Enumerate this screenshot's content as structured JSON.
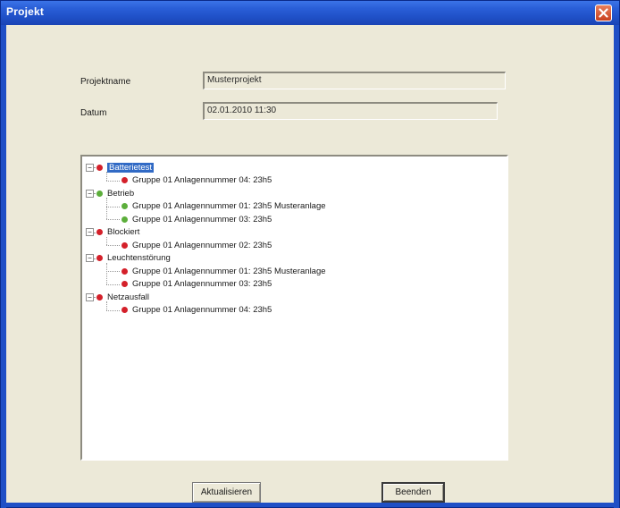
{
  "window": {
    "title": "Projekt"
  },
  "fields": {
    "project_name_label": "Projektname",
    "project_name_value": "Musterprojekt",
    "date_label": "Datum",
    "date_value": "02.01.2010 11:30"
  },
  "tree": {
    "status_colors": {
      "error": "#d4202a",
      "ok": "#5cae3b"
    },
    "groups": [
      {
        "label": "Batterietest",
        "status": "error",
        "selected": true,
        "children": [
          {
            "label": "Gruppe 01 Anlagennummer 04: 23h5",
            "status": "error"
          }
        ]
      },
      {
        "label": "Betrieb",
        "status": "ok",
        "children": [
          {
            "label": "Gruppe 01 Anlagennummer 01: 23h5 Musteranlage",
            "status": "ok"
          },
          {
            "label": "Gruppe 01 Anlagennummer 03: 23h5",
            "status": "ok"
          }
        ]
      },
      {
        "label": "Blockiert",
        "status": "error",
        "children": [
          {
            "label": "Gruppe 01 Anlagennummer 02: 23h5",
            "status": "error"
          }
        ]
      },
      {
        "label": "Leuchtenstörung",
        "status": "error",
        "children": [
          {
            "label": "Gruppe 01 Anlagennummer 01: 23h5 Musteranlage",
            "status": "error"
          },
          {
            "label": "Gruppe 01 Anlagennummer 03: 23h5",
            "status": "error"
          }
        ]
      },
      {
        "label": "Netzausfall",
        "status": "error",
        "children": [
          {
            "label": "Gruppe 01 Anlagennummer 04: 23h5",
            "status": "error"
          }
        ]
      }
    ]
  },
  "buttons": {
    "refresh_label": "Aktualisieren",
    "close_label": "Beenden"
  },
  "icons": {
    "close": "close-x-icon",
    "expander": "minus-expander-icon"
  }
}
